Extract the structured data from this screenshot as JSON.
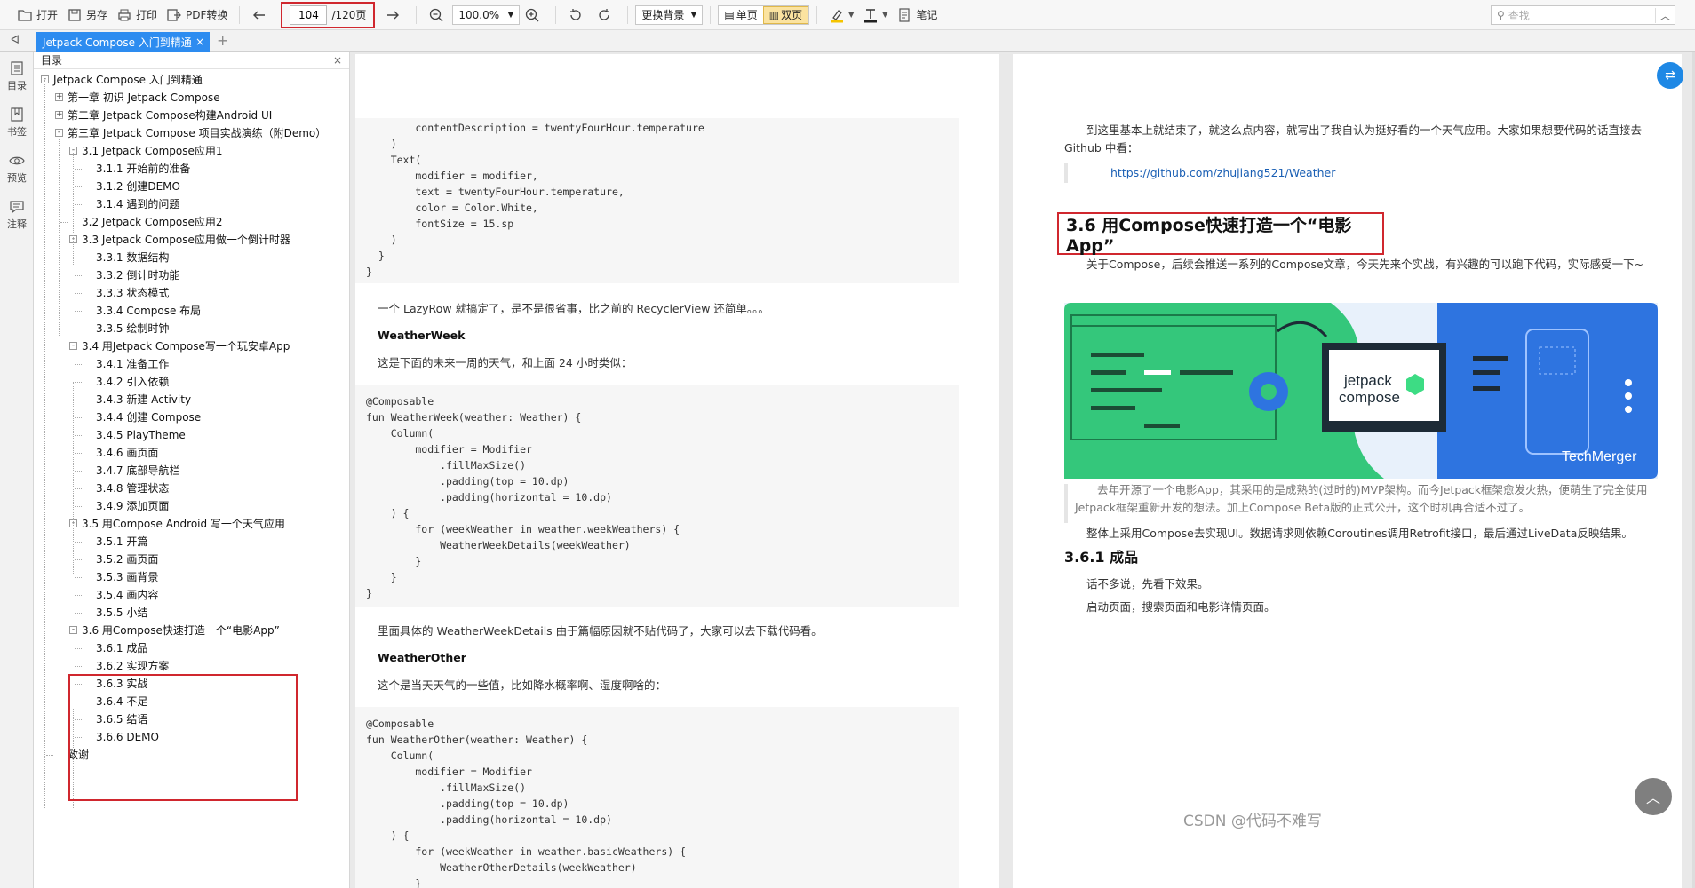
{
  "toolbar": {
    "open": "打开",
    "save_as": "另存",
    "print": "打印",
    "pdf_convert": "PDF转换",
    "current_page": "104",
    "total_pages": "/120页",
    "zoom": "100.0%",
    "background": "更换背景",
    "single_page": "单页",
    "double_page": "双页",
    "notes": "笔记",
    "search_placeholder": "查找",
    "highlight_color": "#f5c400",
    "text_color": "#222222"
  },
  "tab": {
    "title": "Jetpack Compose 入门到精通"
  },
  "rail": {
    "toc": "目录",
    "bookmark": "书签",
    "preview": "预览",
    "annotate": "注释"
  },
  "toc": {
    "header": "目录",
    "items": [
      {
        "label": "Jetpack Compose 入门到精通",
        "level": 0,
        "toggle": "-"
      },
      {
        "label": "第一章 初识 Jetpack Compose",
        "level": 1,
        "toggle": "+"
      },
      {
        "label": "第二章 Jetpack Compose构建Android UI",
        "level": 1,
        "toggle": "+"
      },
      {
        "label": "第三章  Jetpack Compose 项目实战演练（附Demo）",
        "level": 1,
        "toggle": "-"
      },
      {
        "label": "3.1 Jetpack Compose应用1",
        "level": 2,
        "toggle": "-"
      },
      {
        "label": "3.1.1 开始前的准备",
        "level": 3,
        "toggle": ""
      },
      {
        "label": "3.1.2 创建DEMO",
        "level": 3,
        "toggle": ""
      },
      {
        "label": "3.1.4 遇到的问题",
        "level": 3,
        "toggle": ""
      },
      {
        "label": "3.2 Jetpack Compose应用2",
        "level": 2,
        "toggle": ""
      },
      {
        "label": "3.3 Jetpack Compose应用做一个倒计时器",
        "level": 2,
        "toggle": "-"
      },
      {
        "label": "3.3.1 数据结构",
        "level": 3,
        "toggle": ""
      },
      {
        "label": "3.3.2 倒计时功能",
        "level": 3,
        "toggle": ""
      },
      {
        "label": "3.3.3 状态模式",
        "level": 3,
        "toggle": ""
      },
      {
        "label": "3.3.4 Compose 布局",
        "level": 3,
        "toggle": ""
      },
      {
        "label": "3.3.5 绘制时钟",
        "level": 3,
        "toggle": ""
      },
      {
        "label": "3.4 用Jetpack Compose写一个玩安卓App",
        "level": 2,
        "toggle": "-"
      },
      {
        "label": "3.4.1 准备工作",
        "level": 3,
        "toggle": ""
      },
      {
        "label": "3.4.2 引入依赖",
        "level": 3,
        "toggle": ""
      },
      {
        "label": "3.4.3 新建 Activity",
        "level": 3,
        "toggle": ""
      },
      {
        "label": "3.4.4 创建 Compose",
        "level": 3,
        "toggle": ""
      },
      {
        "label": "3.4.5 PlayTheme",
        "level": 3,
        "toggle": ""
      },
      {
        "label": "3.4.6   画页面",
        "level": 3,
        "toggle": ""
      },
      {
        "label": "3.4.7 底部导航栏",
        "level": 3,
        "toggle": ""
      },
      {
        "label": "3.4.8 管理状态",
        "level": 3,
        "toggle": ""
      },
      {
        "label": "3.4.9 添加页面",
        "level": 3,
        "toggle": ""
      },
      {
        "label": "3.5 用Compose Android 写一个天气应用",
        "level": 2,
        "toggle": "-"
      },
      {
        "label": "3.5.1 开篇",
        "level": 3,
        "toggle": ""
      },
      {
        "label": "3.5.2 画页面",
        "level": 3,
        "toggle": ""
      },
      {
        "label": "3.5.3 画背景",
        "level": 3,
        "toggle": ""
      },
      {
        "label": "3.5.4 画内容",
        "level": 3,
        "toggle": ""
      },
      {
        "label": "3.5.5 小结",
        "level": 3,
        "toggle": ""
      },
      {
        "label": "3.6 用Compose快速打造一个“电影App”",
        "level": 2,
        "toggle": "-"
      },
      {
        "label": "3.6.1 成品",
        "level": 3,
        "toggle": ""
      },
      {
        "label": "3.6.2 实现方案",
        "level": 3,
        "toggle": ""
      },
      {
        "label": "3.6.3 实战",
        "level": 3,
        "toggle": ""
      },
      {
        "label": "3.6.4 不足",
        "level": 3,
        "toggle": ""
      },
      {
        "label": "3.6.5 结语",
        "level": 3,
        "toggle": ""
      },
      {
        "label": "3.6.6 DEMO",
        "level": 3,
        "toggle": ""
      },
      {
        "label": "致谢",
        "level": 1,
        "toggle": ""
      }
    ]
  },
  "left_page": {
    "code1": "        contentDescription = twentyFourHour.temperature\n    )\n    Text(\n        modifier = modifier,\n        text = twentyFourHour.temperature,\n        color = Color.White,\n        fontSize = 15.sp\n    )\n  }\n}",
    "p1": "一个 LazyRow 就搞定了，是不是很省事，比之前的 RecyclerView 还简单。。。",
    "h1": "WeatherWeek",
    "p2": "这是下面的未来一周的天气，和上面 24 小时类似：",
    "code2": "@Composable\nfun WeatherWeek(weather: Weather) {\n    Column(\n        modifier = Modifier\n            .fillMaxSize()\n            .padding(top = 10.dp)\n            .padding(horizontal = 10.dp)\n    ) {\n        for (weekWeather in weather.weekWeathers) {\n            WeatherWeekDetails(weekWeather)\n        }\n    }\n}",
    "p3": "里面具体的 WeatherWeekDetails 由于篇幅原因就不贴代码了，大家可以去下载代码看。",
    "h2": "WeatherOther",
    "p4": "这个是当天天气的一些值，比如降水概率啊、湿度啊啥的：",
    "code3": "@Composable\nfun WeatherOther(weather: Weather) {\n    Column(\n        modifier = Modifier\n            .fillMaxSize()\n            .padding(top = 10.dp)\n            .padding(horizontal = 10.dp)\n    ) {\n        for (weekWeather in weather.basicWeathers) {\n            WeatherOtherDetails(weekWeather)\n        }"
  },
  "right_page": {
    "intro": "到这里基本上就结束了，就这么点内容，就写出了我自认为挺好看的一个天气应用。大家如果想要代码的话直接去 Github 中看：",
    "link": "https://github.com/zhujiang521/Weather",
    "section_title": "3.6 用Compose快速打造一个“电影App”",
    "p1": "关于Compose，后续会推送一系列的Compose文章，今天先来个实战，有兴趣的可以跑下代码，实际感受一下~",
    "banner_text1": "jetpack",
    "banner_text2": "compose",
    "banner_brand": "TechMerger",
    "quote": "去年开源了一个电影App，其采用的是成熟的(过时的)MVP架构。而今Jetpack框架愈发火热，便萌生了完全使用Jetpack框架重新开发的想法。加上Compose Beta版的正式公开，这个时机再合适不过了。",
    "p2": "整体上采用Compose去实现UI。数据请求则依赖Coroutines调用Retrofit接口，最后通过LiveData反映结果。",
    "sub": "3.6.1 成品",
    "p3": "话不多说，先看下效果。",
    "p4": "启动页面，搜索页面和电影详情页面。"
  },
  "watermark": "CSDN @代码不难写"
}
